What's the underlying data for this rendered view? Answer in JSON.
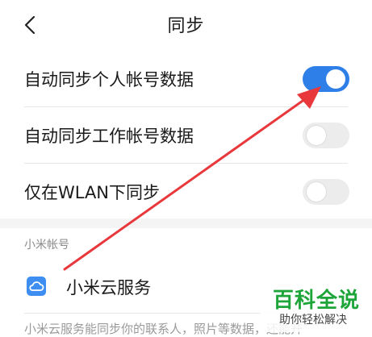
{
  "header": {
    "title": "同步",
    "back_icon": "chevron-left-icon"
  },
  "sync_options": [
    {
      "label": "自动同步个人帐号数据",
      "enabled": true
    },
    {
      "label": "自动同步工作帐号数据",
      "enabled": false
    },
    {
      "label": "仅在WLAN下同步",
      "enabled": false
    }
  ],
  "account_section": {
    "title": "小米帐号",
    "service": {
      "label": "小米云服务",
      "icon": "cloud-icon"
    },
    "description": "小米云服务能同步你的联系人，照片等数据，还能开"
  },
  "annotation": {
    "color": "#e8383b"
  },
  "watermark": {
    "main": "百科全说",
    "sub": "助你轻松解决"
  },
  "colors": {
    "accent": "#2e7fe8",
    "toggle_off": "#ececec",
    "watermark_green": "#1da53a"
  }
}
